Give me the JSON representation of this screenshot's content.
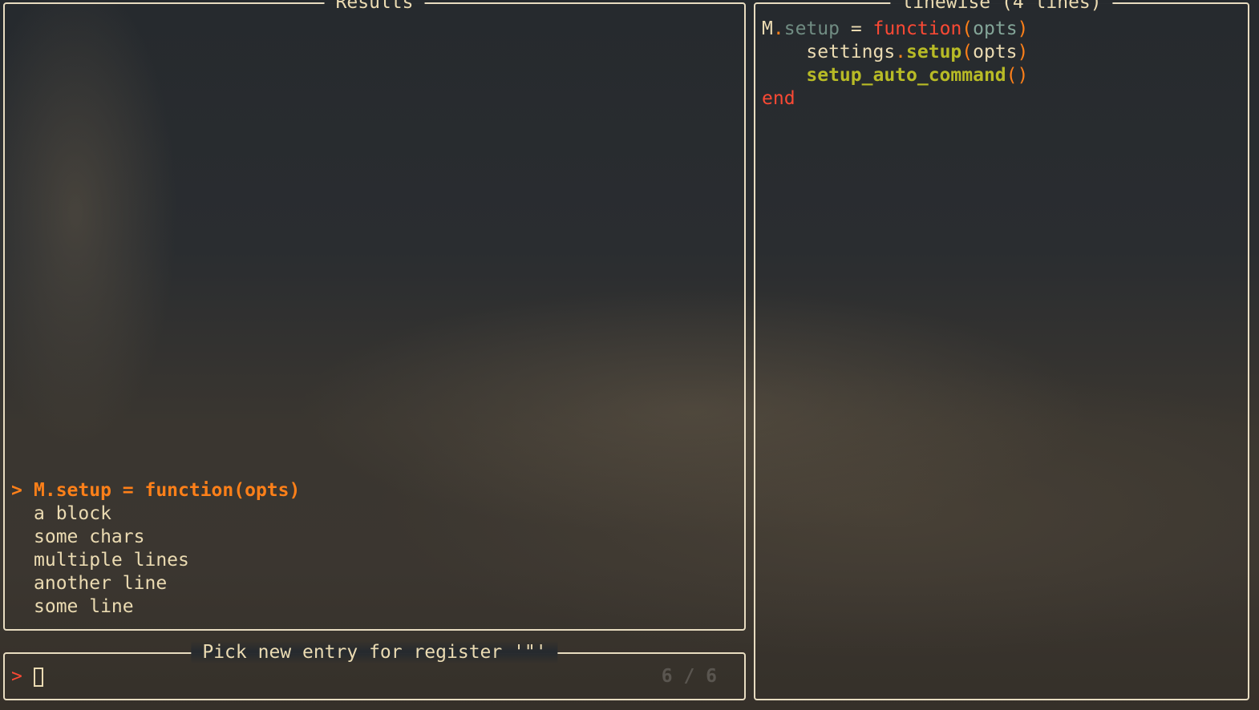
{
  "colors": {
    "border": "#e8dcc0",
    "text": "#ebdbb2",
    "selected": "#fe8019",
    "keyword": "#fb4934",
    "field": "#83a598",
    "function_name": "#b8bb26",
    "counter": "#5a5650"
  },
  "results": {
    "title": "Results",
    "selected_marker": ">",
    "items": [
      {
        "text": "M.setup = function(opts)",
        "selected": true
      },
      {
        "text": "a block",
        "selected": false
      },
      {
        "text": "some chars",
        "selected": false
      },
      {
        "text": "multiple lines",
        "selected": false
      },
      {
        "text": "another line",
        "selected": false
      },
      {
        "text": "some line",
        "selected": false
      }
    ]
  },
  "preview": {
    "title": "linewise (4 lines)",
    "lines": [
      [
        {
          "t": "M",
          "c": "plain"
        },
        {
          "t": ".",
          "c": "dot"
        },
        {
          "t": "setup",
          "c": "field"
        },
        {
          "t": " = ",
          "c": "plain"
        },
        {
          "t": "function",
          "c": "kw"
        },
        {
          "t": "(",
          "c": "paren"
        },
        {
          "t": "opts",
          "c": "param"
        },
        {
          "t": ")",
          "c": "paren"
        }
      ],
      [
        {
          "t": "    settings",
          "c": "plain"
        },
        {
          "t": ".",
          "c": "dot"
        },
        {
          "t": "setup",
          "c": "fn"
        },
        {
          "t": "(",
          "c": "paren"
        },
        {
          "t": "opts",
          "c": "plain"
        },
        {
          "t": ")",
          "c": "paren"
        }
      ],
      [
        {
          "t": "    ",
          "c": "plain"
        },
        {
          "t": "setup_auto_command",
          "c": "fn"
        },
        {
          "t": "()",
          "c": "paren"
        }
      ],
      [
        {
          "t": "end",
          "c": "kw"
        }
      ]
    ]
  },
  "prompt": {
    "title": "Pick new entry for register '\"'",
    "caret": ">",
    "value": "",
    "counter": "6 / 6"
  }
}
